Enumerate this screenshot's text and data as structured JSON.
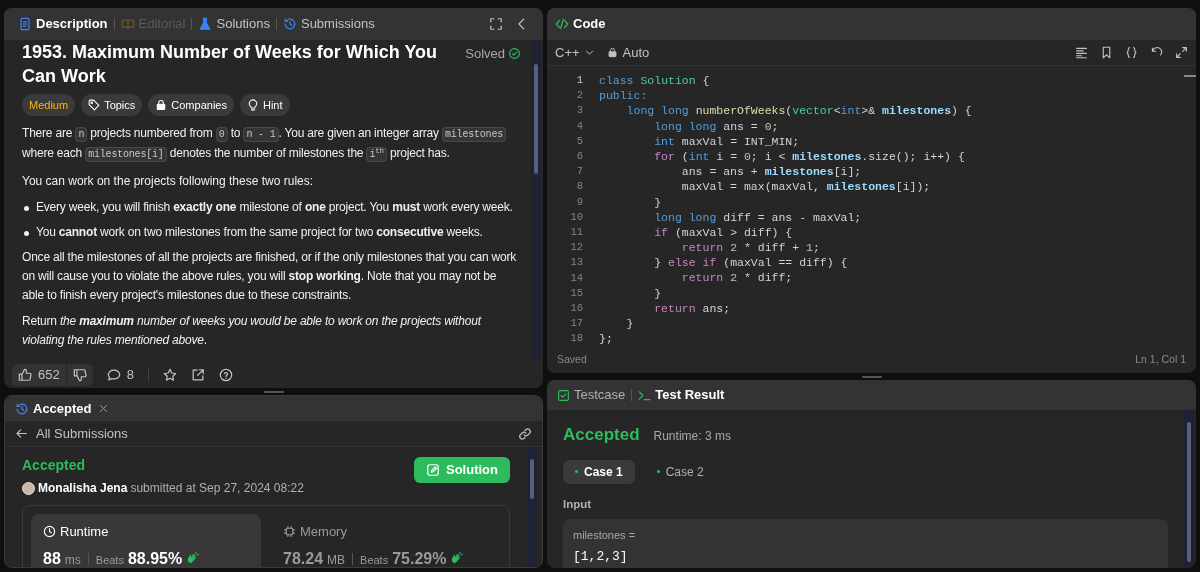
{
  "left_tabs": [
    {
      "label": "Description",
      "selected": true,
      "disabled": false
    },
    {
      "label": "Editorial",
      "selected": false,
      "disabled": true
    },
    {
      "label": "Solutions",
      "selected": false,
      "disabled": false
    },
    {
      "label": "Submissions",
      "selected": false,
      "disabled": false
    }
  ],
  "problem": {
    "title": "1953. Maximum Number of Weeks for Which You Can Work",
    "status": "Solved",
    "tags": [
      {
        "label": "Medium",
        "kind": "difficulty"
      },
      {
        "label": "Topics",
        "kind": "tag"
      },
      {
        "label": "Companies",
        "kind": "lock"
      },
      {
        "label": "Hint",
        "kind": "bulb"
      }
    ],
    "intro": [
      {
        "t": "There are ",
        "kind": "text"
      },
      {
        "t": "n",
        "kind": "code"
      },
      {
        "t": " projects numbered from ",
        "kind": "text"
      },
      {
        "t": "0",
        "kind": "code"
      },
      {
        "t": " to ",
        "kind": "text"
      },
      {
        "t": "n - 1",
        "kind": "code"
      },
      {
        "t": ". You are given an integer array ",
        "kind": "text"
      },
      {
        "t": "milestones",
        "kind": "code"
      },
      {
        "t": " where each ",
        "kind": "text"
      },
      {
        "t": "milestones[i]",
        "kind": "code"
      },
      {
        "t": " denotes the number of milestones the ",
        "kind": "text"
      },
      {
        "t": "i$^{th}$",
        "kind": "code"
      },
      {
        "t": " project has.",
        "kind": "text"
      }
    ],
    "rules_intro": "You can work on the projects following these two rules:",
    "rules": [
      "Every week, you will finish **exactly one** milestone of **one** project. You **must** work every week.",
      "You **cannot** work on two milestones from the same project for two **consecutive** weeks."
    ],
    "paragraphs": [
      [
        {
          "t": "Once all the milestones of all the projects are finished, or if the only milestones that you can work on will cause you to violate the above rules, you will **stop working**. Note that you may not be able to finish every project's milestones due to these constraints.",
          "kind": "text"
        }
      ],
      [
        {
          "t": "Return ",
          "kind": "text"
        },
        {
          "t": "the **maximum** number of weeks you would be able to work on the projects without violating the rules mentioned above",
          "kind": "italic"
        },
        {
          "t": ".",
          "kind": "text"
        }
      ]
    ],
    "likes": "652",
    "comments": "8"
  },
  "submission": {
    "tab": "Accepted",
    "back": "All Submissions",
    "status": "Accepted",
    "user": "Monalisha Jena",
    "submitted": "submitted at Sep 27, 2024 08:22",
    "solution_button": "Solution",
    "stats": [
      {
        "label": "Runtime",
        "value": "88",
        "unit": "ms",
        "beats_label": "Beats",
        "beats": "88.95%",
        "selected": true,
        "kind": "clock"
      },
      {
        "label": "Memory",
        "value": "78.24",
        "unit": "MB",
        "beats_label": "Beats",
        "beats": "75.29%",
        "selected": false,
        "kind": "chip"
      }
    ]
  },
  "editor": {
    "title": "Code",
    "language": "C++",
    "mode": "Auto",
    "lines": [
      [
        {
          "text": "class ",
          "kind": "kw"
        },
        {
          "text": "Solution",
          "kind": "type"
        },
        {
          "text": " {",
          "kind": "p"
        }
      ],
      [
        {
          "text": "public:",
          "kind": "kw"
        }
      ],
      [
        {
          "text": "    long long ",
          "kind": "kw"
        },
        {
          "text": "numberOfWeeks",
          "kind": "fn"
        },
        {
          "text": "(",
          "kind": "p"
        },
        {
          "text": "vector",
          "kind": "type"
        },
        {
          "text": "<",
          "kind": "p"
        },
        {
          "text": "int",
          "kind": "kw"
        },
        {
          "text": ">& ",
          "kind": "p"
        },
        {
          "text": "milestones",
          "kind": "var"
        },
        {
          "text": ") {",
          "kind": "p"
        }
      ],
      [
        {
          "text": "        long long ",
          "kind": "kw"
        },
        {
          "text": "ans = ",
          "kind": "p"
        },
        {
          "text": "0",
          "kind": "num"
        },
        {
          "text": ";",
          "kind": "p"
        }
      ],
      [
        {
          "text": "        int ",
          "kind": "kw"
        },
        {
          "text": "maxVal = INT_MIN;",
          "kind": "p"
        }
      ],
      [
        {
          "text": "        for ",
          "kind": "ctl"
        },
        {
          "text": "(",
          "kind": "p"
        },
        {
          "text": "int ",
          "kind": "kw"
        },
        {
          "text": "i = ",
          "kind": "p"
        },
        {
          "text": "0",
          "kind": "num"
        },
        {
          "text": "; i < ",
          "kind": "p"
        },
        {
          "text": "milestones",
          "kind": "var"
        },
        {
          "text": ".size(); i++) {",
          "kind": "p"
        }
      ],
      [
        {
          "text": "            ans = ans + ",
          "kind": "p"
        },
        {
          "text": "milestones",
          "kind": "var"
        },
        {
          "text": "[i];",
          "kind": "p"
        }
      ],
      [
        {
          "text": "            maxVal = max(maxVal, ",
          "kind": "p"
        },
        {
          "text": "milestones",
          "kind": "var"
        },
        {
          "text": "[i]);",
          "kind": "p"
        }
      ],
      [
        {
          "text": "        }",
          "kind": "p"
        }
      ],
      [
        {
          "text": "        long long ",
          "kind": "kw"
        },
        {
          "text": "diff = ans - maxVal;",
          "kind": "p"
        }
      ],
      [
        {
          "text": "        if ",
          "kind": "ctl"
        },
        {
          "text": "(maxVal > diff) {",
          "kind": "p"
        }
      ],
      [
        {
          "text": "            return ",
          "kind": "ctl"
        },
        {
          "text": "2",
          "kind": "num"
        },
        {
          "text": " * diff + ",
          "kind": "p"
        },
        {
          "text": "1",
          "kind": "num"
        },
        {
          "text": ";",
          "kind": "p"
        }
      ],
      [
        {
          "text": "        } ",
          "kind": "p"
        },
        {
          "text": "else if ",
          "kind": "ctl"
        },
        {
          "text": "(maxVal == diff) {",
          "kind": "p"
        }
      ],
      [
        {
          "text": "            return ",
          "kind": "ctl"
        },
        {
          "text": "2",
          "kind": "num"
        },
        {
          "text": " * diff;",
          "kind": "p"
        }
      ],
      [
        {
          "text": "        }",
          "kind": "p"
        }
      ],
      [
        {
          "text": "        return ",
          "kind": "ctl"
        },
        {
          "text": "ans;",
          "kind": "p"
        }
      ],
      [
        {
          "text": "    }",
          "kind": "p"
        }
      ],
      [
        {
          "text": "};",
          "kind": "p"
        }
      ]
    ],
    "line_numbers": [
      "1",
      "2",
      "3",
      "4",
      "5",
      "6",
      "7",
      "8",
      "9",
      "10",
      "11",
      "12",
      "13",
      "14",
      "15",
      "16",
      "17",
      "18"
    ],
    "saved": "Saved",
    "cursor": "Ln 1, Col 1"
  },
  "result": {
    "tabs": [
      {
        "label": "Testcase",
        "selected": false,
        "kind": "check"
      },
      {
        "label": "Test Result",
        "selected": true,
        "kind": "terminal"
      }
    ],
    "status": "Accepted",
    "runtime": "Runtime: 3 ms",
    "cases": [
      {
        "label": "Case 1",
        "selected": true
      },
      {
        "label": "Case 2",
        "selected": false
      }
    ],
    "input_label": "Input",
    "param": "milestones =",
    "value": "[1,2,3]"
  }
}
